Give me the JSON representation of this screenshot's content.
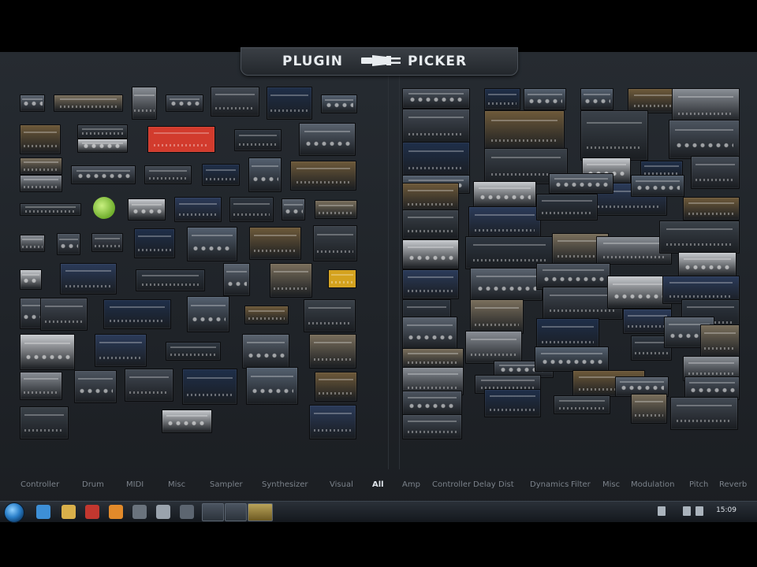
{
  "window": {
    "title_left": "PLUGIN",
    "title_right": "PICKER"
  },
  "categories": [
    {
      "label": "Controller",
      "active": false
    },
    {
      "label": "Drum",
      "active": false
    },
    {
      "label": "MIDI",
      "active": false
    },
    {
      "label": "Misc",
      "active": false
    },
    {
      "label": "Sampler",
      "active": false
    },
    {
      "label": "Synthesizer",
      "active": false
    },
    {
      "label": "Visual",
      "active": false
    },
    {
      "label": "All",
      "active": true
    },
    {
      "label": "Amp",
      "active": false
    },
    {
      "label": "Controller",
      "active": false
    },
    {
      "label": "Delay",
      "active": false
    },
    {
      "label": "Dist",
      "active": false
    },
    {
      "label": "Dynamics",
      "active": false
    },
    {
      "label": "Filter",
      "active": false
    },
    {
      "label": "Misc",
      "active": false
    },
    {
      "label": "Modulation",
      "active": false
    },
    {
      "label": "Pitch",
      "active": false
    },
    {
      "label": "Reverb",
      "active": false
    }
  ],
  "taskbar": {
    "clock": "15:09",
    "icons": [
      "ie-icon",
      "folder-icon",
      "media-icon",
      "fl-studio-icon",
      "app-icon",
      "shield-icon",
      "app-icon-2"
    ]
  },
  "colors": {
    "accent": "#d23b2d",
    "panel_bg": "#23282e",
    "category_active": "#dfe4ea",
    "category_inactive": "#7b828a"
  }
}
